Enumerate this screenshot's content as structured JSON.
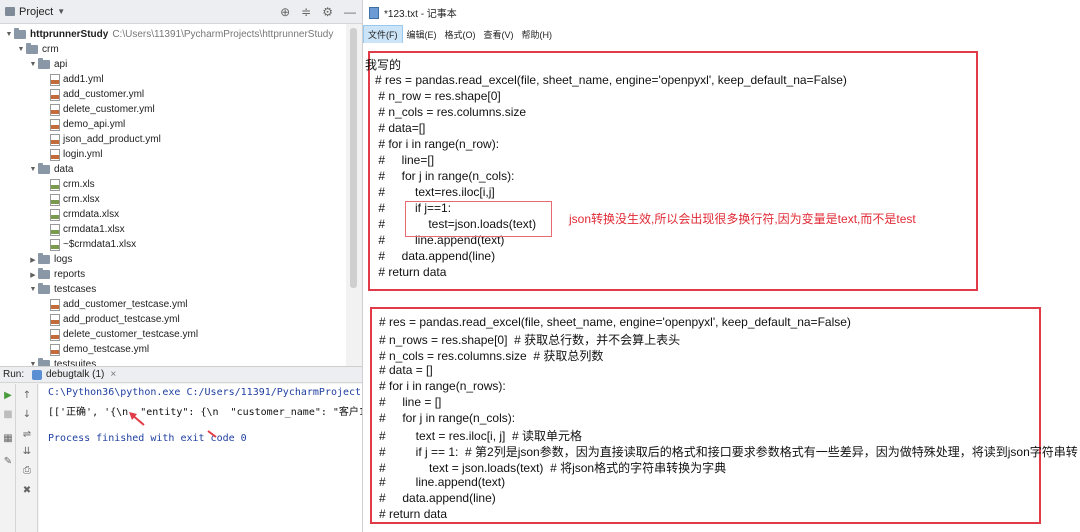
{
  "ide": {
    "project_header": {
      "title": "Project",
      "tools": [
        "⊕",
        "≑",
        "⚙",
        "—"
      ]
    },
    "tree": [
      {
        "level": 0,
        "kind": "folder",
        "expanded": true,
        "label": "httprunnerStudy",
        "path": "C:\\Users\\11391\\PycharmProjects\\httprunnerStudy",
        "bold": true
      },
      {
        "level": 1,
        "kind": "folder",
        "expanded": true,
        "label": "crm"
      },
      {
        "level": 2,
        "kind": "folder",
        "expanded": true,
        "label": "api"
      },
      {
        "level": 3,
        "kind": "yml",
        "label": "add1.yml"
      },
      {
        "level": 3,
        "kind": "yml",
        "label": "add_customer.yml"
      },
      {
        "level": 3,
        "kind": "yml",
        "label": "delete_customer.yml"
      },
      {
        "level": 3,
        "kind": "yml",
        "label": "demo_api.yml"
      },
      {
        "level": 3,
        "kind": "yml",
        "label": "json_add_product.yml"
      },
      {
        "level": 3,
        "kind": "yml",
        "label": "login.yml"
      },
      {
        "level": 2,
        "kind": "folder",
        "expanded": true,
        "label": "data"
      },
      {
        "level": 3,
        "kind": "xls",
        "label": "crm.xls"
      },
      {
        "level": 3,
        "kind": "xls",
        "label": "crm.xlsx"
      },
      {
        "level": 3,
        "kind": "xls",
        "label": "crmdata.xlsx"
      },
      {
        "level": 3,
        "kind": "xls",
        "label": "crmdata1.xlsx"
      },
      {
        "level": 3,
        "kind": "xls",
        "label": "~$crmdata1.xlsx"
      },
      {
        "level": 2,
        "kind": "folder",
        "expanded": false,
        "label": "logs"
      },
      {
        "level": 2,
        "kind": "folder",
        "expanded": false,
        "label": "reports"
      },
      {
        "level": 2,
        "kind": "folder",
        "expanded": true,
        "label": "testcases"
      },
      {
        "level": 3,
        "kind": "yml",
        "label": "add_customer_testcase.yml"
      },
      {
        "level": 3,
        "kind": "yml",
        "label": "add_product_testcase.yml"
      },
      {
        "level": 3,
        "kind": "yml",
        "label": "delete_customer_testcase.yml"
      },
      {
        "level": 3,
        "kind": "yml",
        "label": "demo_testcase.yml"
      },
      {
        "level": 2,
        "kind": "folder",
        "expanded": true,
        "label": "testsuites"
      }
    ],
    "run": {
      "label": "Run:",
      "tab": "debugtalk (1)",
      "close": "×",
      "lines": [
        "C:\\Python36\\python.exe C:/Users/11391/PycharmProjects",
        "[['正确', '{\\n  \"entity\": {\\n  \"customer_name\": \"客户123",
        "Process finished with exit code 0"
      ]
    }
  },
  "notepad": {
    "title": "*123.txt - 记事本",
    "menu": [
      "文件(F)",
      "编辑(E)",
      "格式(O)",
      "查看(V)",
      "帮助(H)"
    ],
    "block1": {
      "heading": "我写的",
      "lines": [
        "# res = pandas.read_excel(file, sheet_name, engine='openpyxl', keep_default_na=False)",
        " # n_row = res.shape[0]",
        " # n_cols = res.columns.size",
        " # data=[]",
        " # for i in range(n_row):",
        " #     line=[]",
        " #     for j in range(n_cols):",
        " #         text=res.iloc[i,j]",
        " #         if j==1:",
        " #             test=json.loads(text)",
        " #         line.append(text)",
        " #     data.append(line)",
        " # return data"
      ],
      "note": "json转换没生效,所以会出现很多换行符,因为变量是text,而不是test"
    },
    "block2": {
      "lines": [
        "# res = pandas.read_excel(file, sheet_name, engine='openpyxl', keep_default_na=False)",
        "# n_rows = res.shape[0]  # 获取总行数，并不会算上表头",
        "# n_cols = res.columns.size  # 获取总列数",
        "# data = []",
        "# for i in range(n_rows):",
        "#     line = []",
        "#     for j in range(n_cols):",
        "#         text = res.iloc[i, j]  # 读取单元格",
        "#         if j == 1:  # 第2列是json参数，因为直接读取后的格式和接口要求参数格式有一些差异，因为做特殊处理，将读到json字符串转",
        "#             text = json.loads(text)  # 将json格式的字符串转换为字典",
        "#         line.append(text)",
        "#     data.append(line)",
        "# return data"
      ]
    }
  },
  "colors": {
    "annotation_red": "#e03b46"
  }
}
